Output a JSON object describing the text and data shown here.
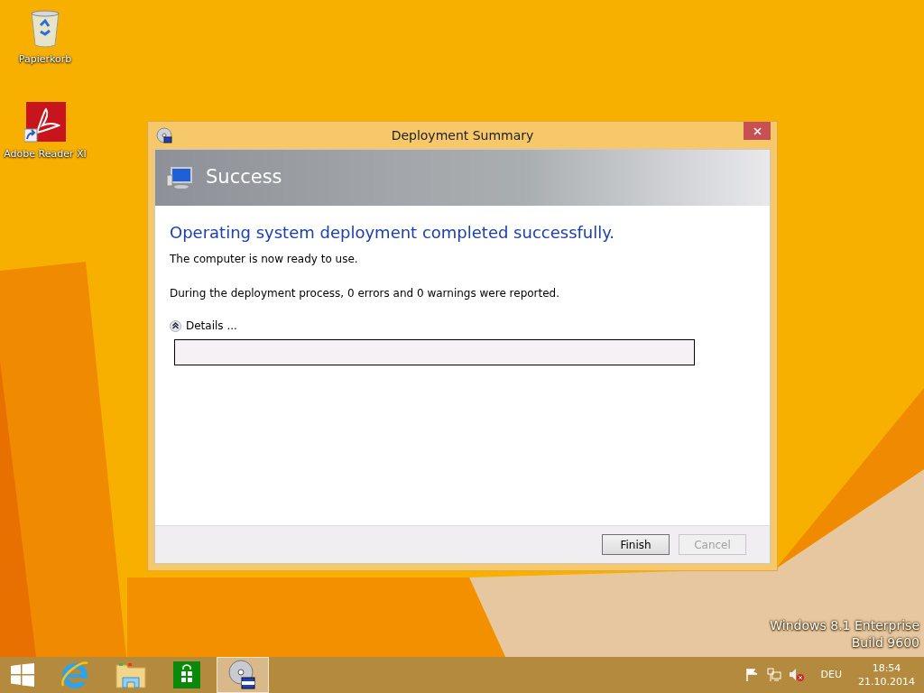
{
  "desktop_icons": [
    {
      "kind": "recycle-bin",
      "label": "Papierkorb"
    },
    {
      "kind": "pdf-shortcut",
      "label": "Adobe Reader XI"
    }
  ],
  "window": {
    "title": "Deployment Summary",
    "banner_title": "Success",
    "heading": "Operating system deployment completed successfully.",
    "message": "The computer is now ready to use.",
    "summary": "During the deployment process, 0 errors and 0 warnings were reported.",
    "details": {
      "label": "Details ...",
      "expanded": true
    },
    "buttons": [
      {
        "label": "Finish",
        "disabled": false
      },
      {
        "label": "Cancel",
        "disabled": true
      }
    ]
  },
  "watermark_text": [
    "Windows 8.1 Enterprise",
    "Build 9600"
  ],
  "taskbar": {
    "apps": [
      {
        "kind": "browser",
        "selected": false
      },
      {
        "kind": "folder",
        "selected": false
      },
      {
        "kind": "store",
        "selected": false
      },
      {
        "kind": "disc",
        "selected": true
      }
    ],
    "language": "DEU",
    "time": "18:54",
    "date": "21.10.2014"
  }
}
